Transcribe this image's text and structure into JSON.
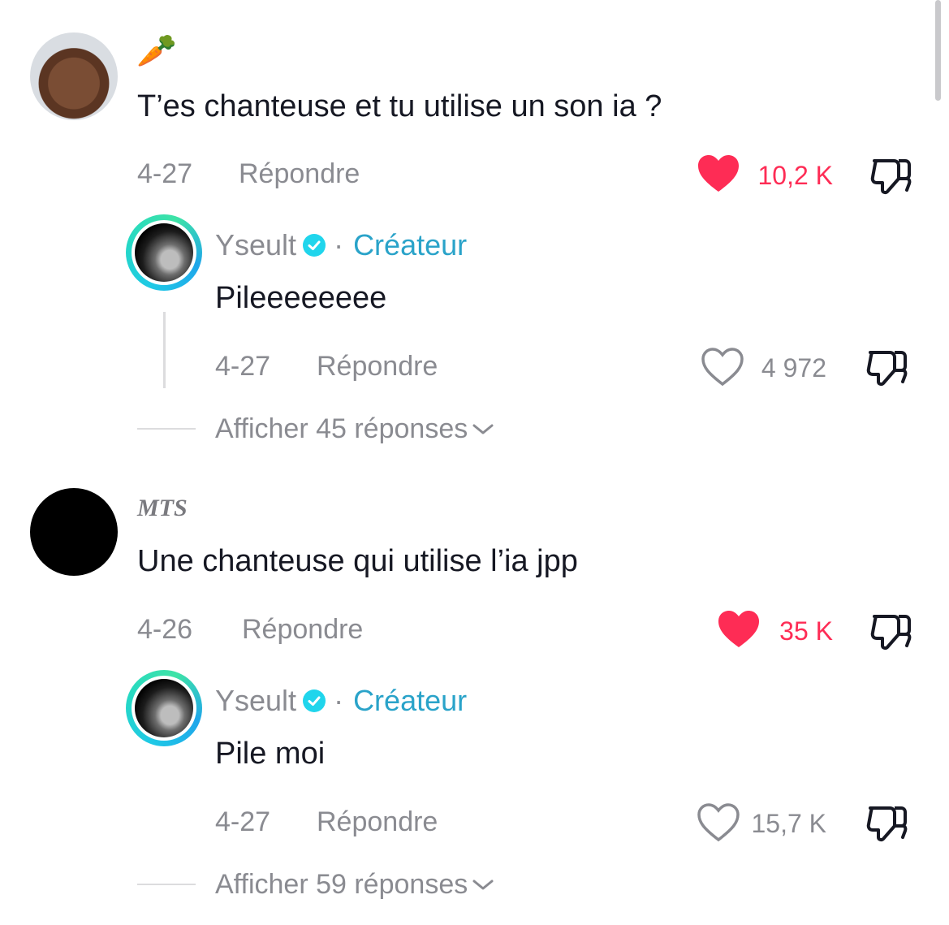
{
  "comments": [
    {
      "avatar_icon": "baby-avatar",
      "author_display": "🥕",
      "text": "T’es chanteuse et tu utilise un son ia ?",
      "date": "4-27",
      "reply_label": "Répondre",
      "likes": "10,2 K",
      "liked": true,
      "reply": {
        "author": "Yseult",
        "separator": "·",
        "role": "Créateur",
        "text": "Pileeeeeeee",
        "date": "4-27",
        "reply_label": "Répondre",
        "likes": "4 972",
        "liked": false
      },
      "view_more_label": "Afficher 45 réponses"
    },
    {
      "avatar_icon": "black-avatar",
      "author_display": "MTS",
      "text": "Une chanteuse qui utilise l’ia jpp",
      "date": "4-26",
      "reply_label": "Répondre",
      "likes": "35 K",
      "liked": true,
      "reply": {
        "author": "Yseult",
        "separator": "·",
        "role": "Créateur",
        "text": "Pile moi",
        "date": "4-27",
        "reply_label": "Répondre",
        "likes": "15,7 K",
        "liked": false
      },
      "view_more_label": "Afficher 59 réponses"
    }
  ],
  "colors": {
    "like_active": "#fe2c55",
    "meta_gray": "#8a8b91",
    "creator_blue": "#2aa3c9",
    "verified_badge": "#20d5ec"
  },
  "icons": [
    "heart-filled-icon",
    "heart-outline-icon",
    "dislike-icon",
    "verified-badge-icon",
    "chevron-down-icon"
  ]
}
